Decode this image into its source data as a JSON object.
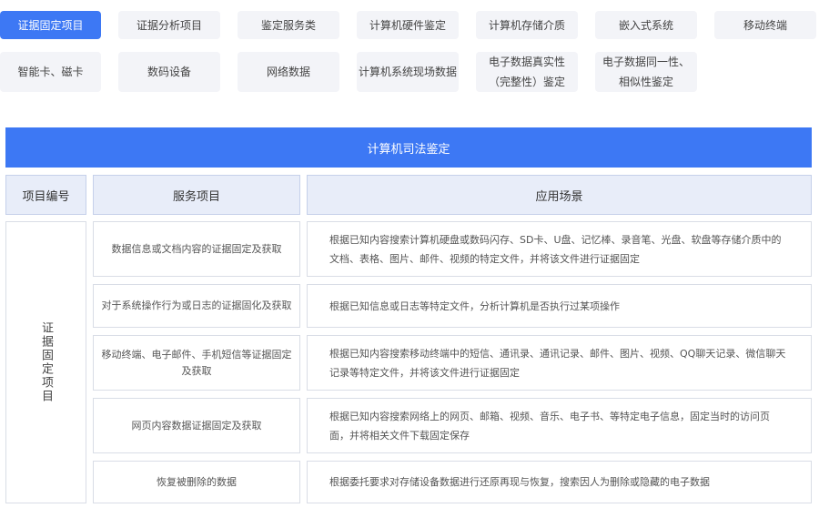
{
  "tabs": [
    {
      "label": "证据固定项目",
      "active": true
    },
    {
      "label": "证据分析项目",
      "active": false
    },
    {
      "label": "鉴定服务类",
      "active": false
    },
    {
      "label": "计算机硬件鉴定",
      "active": false
    },
    {
      "label": "计算机存储介质",
      "active": false
    },
    {
      "label": "嵌入式系统",
      "active": false
    },
    {
      "label": "移动终端",
      "active": false
    },
    {
      "label": "智能卡、磁卡",
      "active": false
    },
    {
      "label": "数码设备",
      "active": false
    },
    {
      "label": "网络数据",
      "active": false
    },
    {
      "label": "计算机系统现场数据",
      "active": false
    },
    {
      "label": "电子数据真实性（完整性）鉴定",
      "active": false
    },
    {
      "label": "电子数据同一性、相似性鉴定",
      "active": false
    }
  ],
  "banner": {
    "title": "计算机司法鉴定"
  },
  "table": {
    "headers": {
      "id": "项目编号",
      "service": "服务项目",
      "scene": "应用场景"
    },
    "group_label": "证据固定项目",
    "rows": [
      {
        "service": "数据信息或文档内容的证据固定及获取",
        "scene": "根据已知内容搜索计算机硬盘或数码闪存、SD卡、U盘、记忆棒、录音笔、光盘、软盘等存储介质中的文档、表格、图片、邮件、视频的特定文件，并将该文件进行证据固定"
      },
      {
        "service": "对于系统操作行为或日志的证据固化及获取",
        "scene": "根据已知信息或日志等特定文件，分析计算机是否执行过某项操作"
      },
      {
        "service": "移动终端、电子邮件、手机短信等证据固定及获取",
        "scene": "根据已知内容搜索移动终端中的短信、通讯录、通讯记录、邮件、图片、视频、QQ聊天记录、微信聊天记录等特定文件，并将该文件进行证据固定"
      },
      {
        "service": "网页内容数据证据固定及获取",
        "scene": "根据已知内容搜索网络上的网页、邮箱、视频、音乐、电子书、等特定电子信息，固定当时的访问页面，并将相关文件下载固定保存"
      },
      {
        "service": "恢复被删除的数据",
        "scene": "根据委托要求对存储设备数据进行还原再现与恢复，搜索因人为删除或隐藏的电子数据"
      }
    ]
  }
}
